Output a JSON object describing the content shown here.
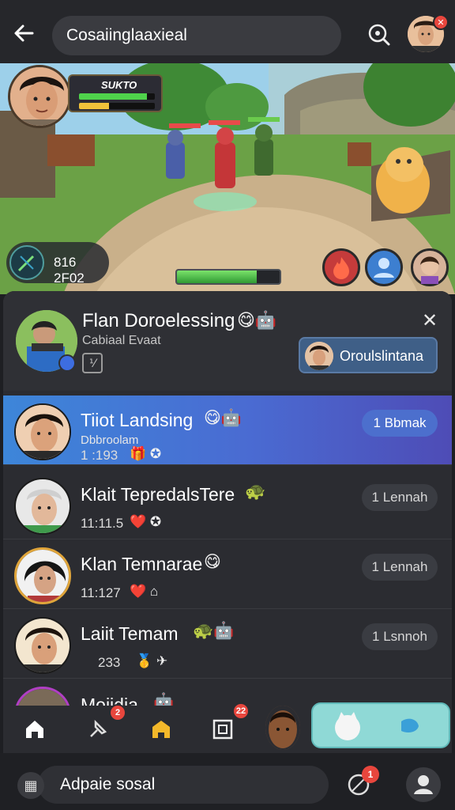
{
  "topbar": {
    "search_text": "Cosaiinglaaxieal",
    "badge_count": ""
  },
  "scene": {
    "hero_name": "SUKTO",
    "score": "816 2F02",
    "hp_fraction": 0.9,
    "mana_fraction": 0.4,
    "xp_fraction": 0.78
  },
  "sheet": {
    "header": {
      "title": "Flan Doroelessing",
      "emojis": "😋🤖",
      "subtitle": "Cabiaal Evaat",
      "icon_glyph": "⅟",
      "pill_text": "Oroulslintana"
    },
    "rows": [
      {
        "name": "Tiiot Landsing",
        "emojis": "😋🤖",
        "sub": "Dbbroolam",
        "time": "1 :193",
        "icons": "🎁 ✪",
        "tag": "1 Bbmak"
      },
      {
        "name": "Klait TepredalsTere",
        "emojis": "🐢",
        "sub": "",
        "time": "11:11.5",
        "icons": "❤️ ✪",
        "tag": "1 Lennah"
      },
      {
        "name": "Klan Temnarae",
        "emojis": "😋",
        "sub": "",
        "time": "11:127",
        "icons": "❤️ ⌂",
        "tag": "1 Lennah"
      },
      {
        "name": "Laiit Temam",
        "emojis": "🐢🤖",
        "sub": "",
        "time": "233",
        "icons": "🥇 ✈",
        "tag": "1 Lsnnoh"
      },
      {
        "name": "Moiidia",
        "emojis": "🤖",
        "sub": "",
        "time": "",
        "icons": "",
        "tag": ""
      }
    ]
  },
  "bottom_nav": {
    "badge_a": "2",
    "badge_b": "22"
  },
  "composer": {
    "placeholder": "Adpaie sosal",
    "badge_count": "1"
  }
}
